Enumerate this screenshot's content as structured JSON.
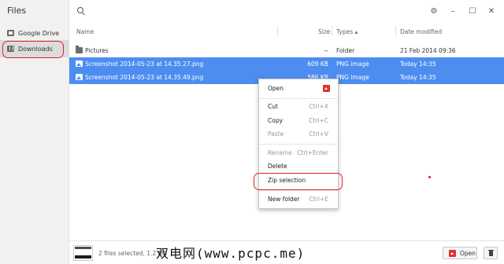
{
  "app": {
    "title": "Files"
  },
  "sidebar": {
    "items": [
      {
        "label": "Google Drive",
        "icon": "google-drive-icon"
      },
      {
        "label": "Downloads",
        "icon": "downloads-icon",
        "selected": true
      }
    ]
  },
  "toolbar": {
    "gear": "⚙",
    "minimize": "–",
    "maximize": "☐",
    "close": "✕"
  },
  "columns": {
    "name": "Name",
    "size": "Size",
    "type": "Types ▴",
    "date": "Date modified"
  },
  "files": [
    {
      "name": "Pictures",
      "size": "--",
      "type": "Folder",
      "date": "21 Feb 2014 09:36",
      "kind": "folder",
      "selected": false
    },
    {
      "name": "Screenshot 2014-05-23 at 14.35.27.png",
      "size": "609 KB",
      "type": "PNG image",
      "date": "Today 14:35",
      "kind": "image",
      "selected": true
    },
    {
      "name": "Screenshot 2014-05-23 at 14.35.49.png",
      "size": "586 KB",
      "type": "PNG image",
      "date": "Today 14:35",
      "kind": "image",
      "selected": true
    }
  ],
  "context_menu": {
    "open": "Open",
    "cut": {
      "label": "Cut",
      "shortcut": "Ctrl+X"
    },
    "copy": {
      "label": "Copy",
      "shortcut": "Ctrl+C"
    },
    "paste": {
      "label": "Paste",
      "shortcut": "Ctrl+V"
    },
    "rename": {
      "label": "Rename",
      "shortcut": "Ctrl+Enter"
    },
    "delete": "Delete",
    "zip": "Zip selection",
    "new_folder": {
      "label": "New folder",
      "shortcut": "Ctrl+E"
    }
  },
  "status": {
    "text": "2 files selected, 1.2 MB"
  },
  "watermark": "双电网(www.pcpc.me)",
  "buttons": {
    "open": "Open"
  },
  "colors": {
    "selection": "#4d8df0",
    "annotation": "#e0202a",
    "app_icon": "#e0322f"
  }
}
